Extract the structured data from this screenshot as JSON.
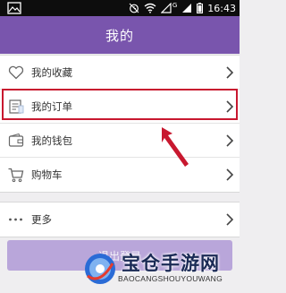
{
  "status_bar": {
    "time": "16:43",
    "network_label": "G"
  },
  "header": {
    "title": "我的"
  },
  "menu_group_1": {
    "items": [
      {
        "label": "我的收藏",
        "icon": "heart-icon"
      },
      {
        "label": "我的订单",
        "icon": "order-icon"
      },
      {
        "label": "我的钱包",
        "icon": "wallet-icon"
      },
      {
        "label": "购物车",
        "icon": "cart-icon"
      }
    ]
  },
  "menu_group_2": {
    "items": [
      {
        "label": "更多",
        "icon": "more-icon"
      }
    ]
  },
  "logout": {
    "label": "退出登录"
  },
  "watermark": {
    "title": "宝仓手游网",
    "subtitle": "BAOCANGSHOUYOUWANG"
  },
  "colors": {
    "accent": "#7955ad",
    "highlight": "#c8182f"
  }
}
